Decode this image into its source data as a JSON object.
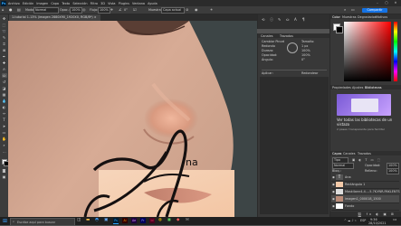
{
  "app": {
    "logo": "Ps"
  },
  "menubar": {
    "items": [
      "Archivo",
      "Edición",
      "Imagen",
      "Capa",
      "Texto",
      "Selección",
      "Filtro",
      "3D",
      "Vista",
      "Plugins",
      "Ventana",
      "Ayuda"
    ],
    "win": [
      "–",
      "▢",
      "✕"
    ]
  },
  "optbar": {
    "mode_label": "Modo:",
    "mode_value": "Normal",
    "opacity_label": "Opac.:",
    "opacity_value": "100%",
    "flow_label": "Flujo:",
    "flow_value": "100%",
    "sample_label": "Muestra:",
    "sample_value": "Capa actual",
    "angle_value": "0°",
    "share_label": "Compartir"
  },
  "document": {
    "tab_title": "1-tutorial 1-13% (imagen 2880X90_1920X0, RGB/8*) ×"
  },
  "canvas": {
    "script_text": "Ana",
    "cursor_text": "na",
    "logo_letter": "A"
  },
  "properties": {
    "tabs": [
      "Canales",
      "Trazados"
    ],
    "rows": [
      {
        "left": "Cambiar Pincel",
        "right": "Tamaño:"
      },
      {
        "left": "Redondo",
        "right": "1 px"
      },
      {
        "left": "Dureza:",
        "right": "100%"
      },
      {
        "left": "Opacidad:",
        "right": "100%"
      },
      {
        "left": "Ángulo:",
        "right": "0°"
      }
    ],
    "footer_left": "Aplicar:",
    "footer_right": "Redondear"
  },
  "color_panel": {
    "tabs": [
      "Color",
      "Muestras",
      "Degradados",
      "Motivos"
    ]
  },
  "libraries": {
    "tabs": [
      "Propiedades",
      "Ajustes",
      "Bibliotecas"
    ],
    "message": "Ver todas las bibliotecas de un vistazo",
    "link": "2 pases: transparente para facilitar",
    "learn": "Más información"
  },
  "layers": {
    "tabs": [
      "Capas",
      "Canales",
      "Trazados"
    ],
    "filter_label": "Tipo",
    "blend_mode": "Normal",
    "opacity_label": "Opacidad:",
    "opacity_value": "100%",
    "lock_label": "Bloq.:",
    "fill_label": "Relleno:",
    "fill_value": "100%",
    "items": [
      {
        "name": "Ana",
        "kind": "text"
      },
      {
        "name": "Rectángulo 1",
        "kind": "shape"
      },
      {
        "name": "Mask4ann4-4...-5-7K-YNR-PAKLENTS",
        "kind": "pixel"
      },
      {
        "name": "imagen1_000018_1500",
        "kind": "photo"
      },
      {
        "name": "Fondo",
        "kind": "white"
      }
    ]
  },
  "taskbar": {
    "search_placeholder": "Escribe aquí para buscar",
    "time": "9:36",
    "date": "28/10/2021",
    "tray_text": "ESP"
  },
  "colors": {
    "accent": "#31a8ff",
    "panel": "#383838",
    "dark": "#2b2b2b"
  }
}
